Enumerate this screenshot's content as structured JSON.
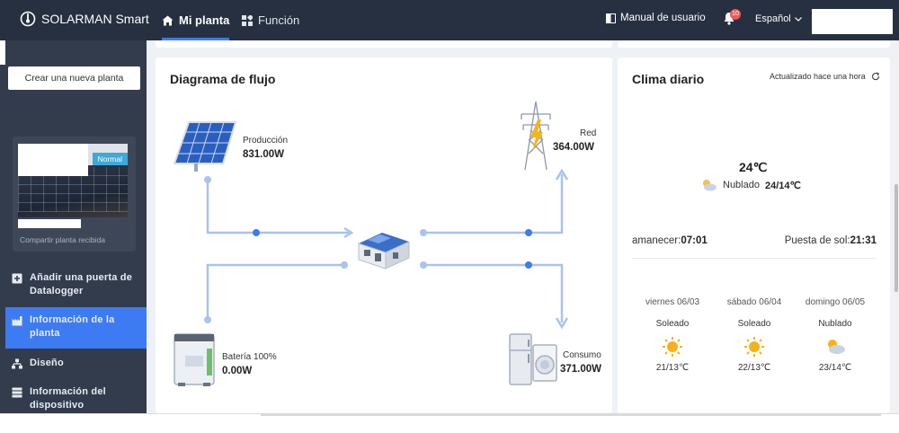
{
  "topbar": {
    "brand": "SOLARMAN Smart",
    "tabs": [
      {
        "label": "Mi planta",
        "icon": "home-icon"
      },
      {
        "label": "Función",
        "icon": "apps-icon"
      }
    ],
    "manual": "Manual de usuario",
    "notifications_count": "10",
    "language": "Español",
    "accent_color": "#3d7bf2"
  },
  "sidebar": {
    "new_plant_button": "Crear una nueva planta",
    "plant_card": {
      "status": "Normal",
      "share_text": "Compartir planta recibida"
    },
    "items": [
      {
        "label_line1": "Añadir una puerta de",
        "label_line2": "Datalogger",
        "icon": "plus-square-icon"
      },
      {
        "label_line1": "Información de la",
        "label_line2": "planta",
        "icon": "factory-icon"
      },
      {
        "label_line1": "Diseño",
        "label_line2": "",
        "icon": "sitemap-icon"
      },
      {
        "label_line1": "Información del",
        "label_line2": "dispositivo",
        "icon": "device-list-icon"
      }
    ]
  },
  "flow": {
    "title": "Diagrama de flujo",
    "production": {
      "label": "Producción",
      "value": "831.00W"
    },
    "grid": {
      "label": "Red",
      "value": "364.00W"
    },
    "battery": {
      "label": "Batería 100%",
      "value": "0.00W"
    },
    "consumption": {
      "label": "Consumo",
      "value": "371.00W"
    },
    "line_color": "#a9c2ee",
    "dot_color": "#3d7bf2"
  },
  "weather": {
    "title": "Clima diario",
    "updated": "Actualizado hace una hora",
    "current_temp": "24℃",
    "current_condition": "Nublado",
    "current_range": "24/14℃",
    "sunrise_label": "amanecer:",
    "sunrise": "07:01",
    "sunset_label": "Puesta de sol:",
    "sunset": "21:31",
    "forecast": [
      {
        "day": "viernes 06/03",
        "condition": "Soleado",
        "temps": "21/13℃",
        "icon": "sun-icon"
      },
      {
        "day": "sábado 06/04",
        "condition": "Soleado",
        "temps": "22/13℃",
        "icon": "sun-icon"
      },
      {
        "day": "domingo 06/05",
        "condition": "Nublado",
        "temps": "23/14℃",
        "icon": "cloudy-icon"
      }
    ]
  }
}
